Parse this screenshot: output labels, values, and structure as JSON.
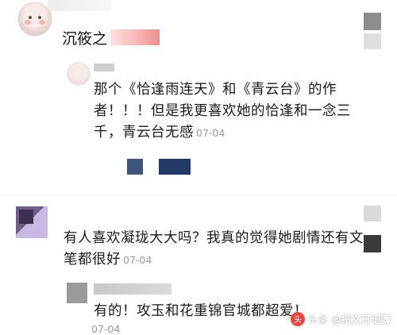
{
  "comments": [
    {
      "author": "沉筱之",
      "text": "",
      "time": ""
    },
    {
      "author": "",
      "text": "那个《恰逢雨连天》和《青云台》的作者！！！但是我更喜欢她的恰逢和一念三千，青云台无感",
      "time": "07-04"
    },
    {
      "author": "",
      "text": "有人喜欢凝珑大大吗？我真的觉得她剧情还有文笔都很好",
      "time": "07-04"
    },
    {
      "author": "",
      "text": "有的！攻玉和花重锦官城都超爱！",
      "time": "07-04"
    }
  ],
  "watermark": {
    "platform": "头条",
    "account": "@扫文日记簿",
    "logo_color": "#e8463f"
  }
}
